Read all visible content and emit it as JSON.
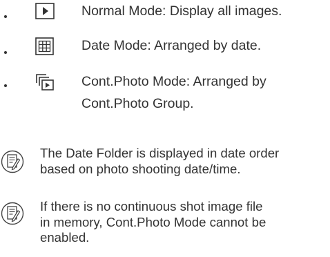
{
  "view_modes": [
    {
      "icon": "play-icon",
      "text": "Normal Mode: Display all images."
    },
    {
      "icon": "calendar-grid-icon",
      "text": "Date Mode: Arranged by date."
    },
    {
      "icon": "stacked-photos-icon",
      "lines": [
        "Cont.Photo Mode: Arranged by",
        "Cont.Photo Group."
      ]
    }
  ],
  "notes": [
    {
      "icon": "memo-icon",
      "lines": [
        "The Date Folder is displayed in date order",
        "based on photo shooting date/time."
      ]
    },
    {
      "icon": "memo-icon",
      "lines": [
        "If there is no continuous shot image file",
        "in memory, Cont.Photo Mode cannot be",
        "enabled."
      ]
    }
  ]
}
